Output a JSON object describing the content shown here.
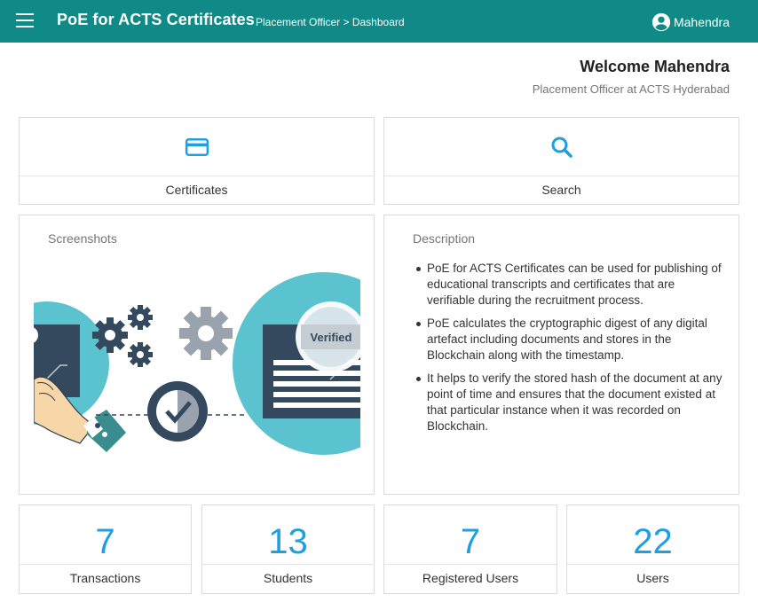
{
  "app": {
    "title": "PoE for ACTS Certificates",
    "breadcrumb": "Placement Officer > Dashboard",
    "user": "Mahendra",
    "primary_color": "#0f8a87",
    "accent_color": "#1e9fe4"
  },
  "welcome": {
    "heading": "Welcome Mahendra",
    "role": "Placement Officer at ACTS Hyderabad"
  },
  "nav_cards": [
    {
      "label": "Certificates",
      "icon": "credit-card-icon"
    },
    {
      "label": "Search",
      "icon": "search-icon"
    }
  ],
  "screenshots": {
    "title": "Screenshots",
    "illustration_text": "Verified"
  },
  "description": {
    "title": "Description",
    "items": [
      "PoE for ACTS Certificates can be used for publishing of educational transcripts and certificates that are verifiable during the recruitment process.",
      "PoE calculates the cryptographic digest of any digital artefact including documents and stores in the Blockchain along with the timestamp.",
      "It helps to verify the stored hash of the document at any point of time and ensures that the document existed at that particular instance when it was recorded on Blockchain."
    ]
  },
  "stats": [
    {
      "value": "7",
      "label": "Transactions"
    },
    {
      "value": "13",
      "label": "Students"
    },
    {
      "value": "7",
      "label": "Registered Users"
    },
    {
      "value": "22",
      "label": "Users"
    }
  ]
}
